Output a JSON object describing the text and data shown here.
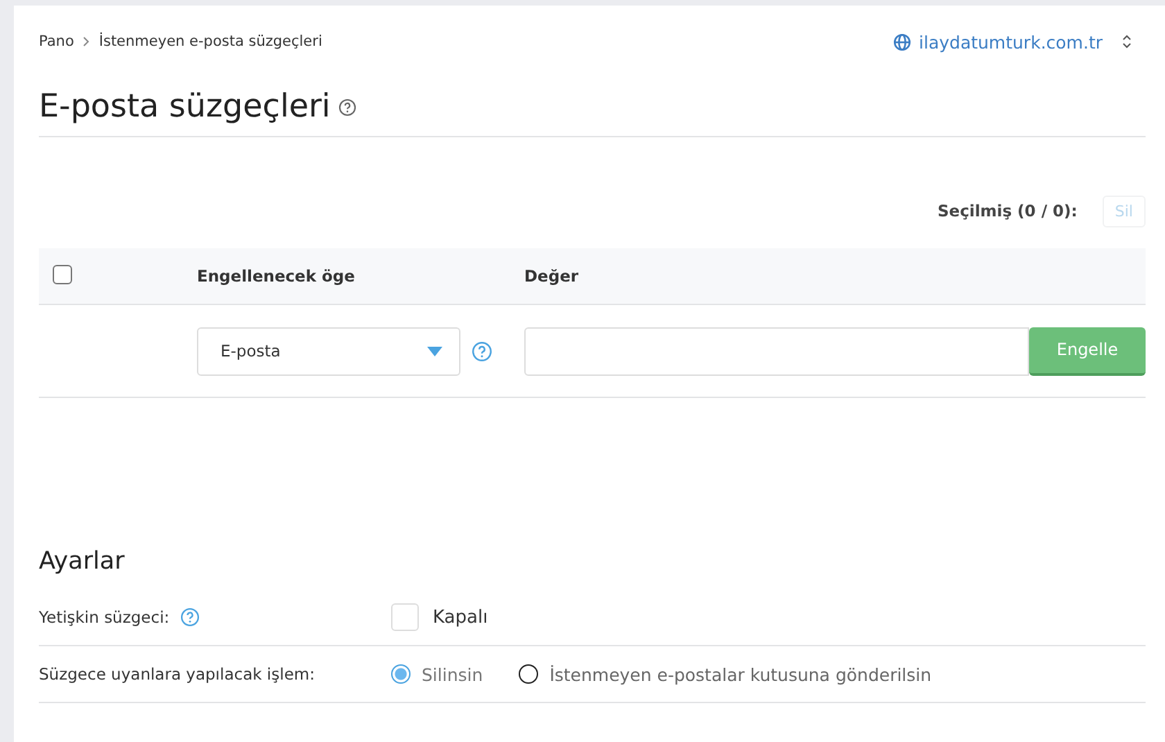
{
  "breadcrumb": [
    {
      "label": "Pano"
    },
    {
      "label": "İstenmeyen e-posta süzgeçleri"
    }
  ],
  "domain_switcher": {
    "label": "ilaydatumturk.com.tr"
  },
  "title": "E-posta süzgeçleri",
  "selection": {
    "label": "Seçilmiş (0 / 0):",
    "delete_button": {
      "label": "Sil",
      "disabled": true
    }
  },
  "table": {
    "select_all": {
      "checked": false
    },
    "columns": [
      "Engellenecek öge",
      "Değer"
    ],
    "new_rule": {
      "type_select": "E-posta",
      "block_button": "Engelle"
    }
  },
  "settings": {
    "title": "Ayarlar",
    "adult_filter": {
      "label": "Yetişkin süzgeci:",
      "checked": false,
      "state_label": "Kapalı"
    },
    "action": {
      "label": "Süzgece uyanlara yapılacak işlem:",
      "options": [
        {
          "label": "Silinsin",
          "selected": true
        },
        {
          "label": "İstenmeyen e-postalar kutusuna gönderilsin",
          "selected": false
        }
      ]
    }
  }
}
